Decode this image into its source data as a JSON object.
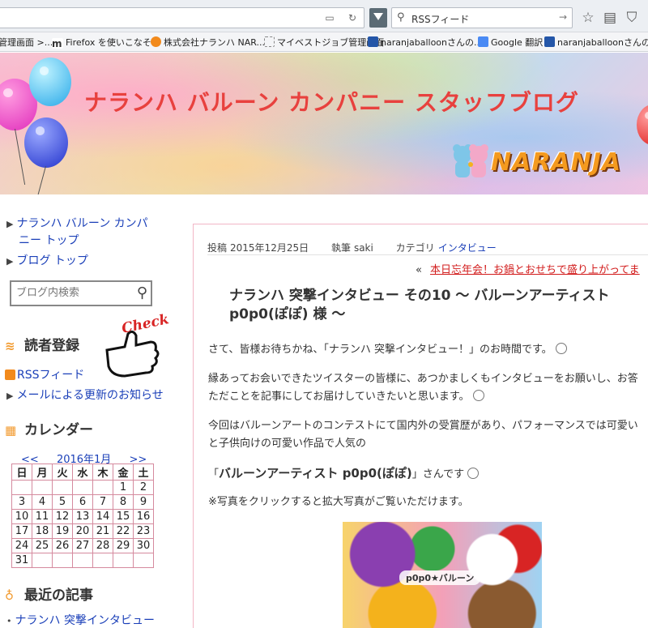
{
  "browser": {
    "search_value": "RSSフィード",
    "bookmarks": [
      "管理画面 >...",
      "Firefox を使いこなそう",
      "株式会社ナランハ NAR...",
      "マイベストジョブ管理画面",
      "naranjaballoonさんの...",
      "Google 翻訳",
      "naranjaballoonさんの..."
    ]
  },
  "header": {
    "blog_title": "ナランハ バルーン カンパニー スタッフブログ",
    "logo_text": "NARANJA"
  },
  "sidebar": {
    "links": [
      {
        "label": "ナランハ バルーン カンパ",
        "label2": "ニー トップ"
      },
      {
        "label": "ブログ トップ"
      }
    ],
    "search_placeholder": "ブログ内検索",
    "reader_heading": "読者登録",
    "check_label": "Check",
    "rss_label": "RSSフィード",
    "email_label": "メールによる更新のお知らせ",
    "calendar_heading": "カレンダー",
    "calendar": {
      "prev": "<<",
      "month": "2016年1月",
      "next": ">>",
      "weekdays": [
        "日",
        "月",
        "火",
        "水",
        "木",
        "金",
        "土"
      ],
      "weeks": [
        [
          "",
          "",
          "",
          "",
          "",
          "1",
          "2"
        ],
        [
          "3",
          "4",
          "5",
          "6",
          "7",
          "8",
          "9"
        ],
        [
          "10",
          "11",
          "12",
          "13",
          "14",
          "15",
          "16"
        ],
        [
          "17",
          "18",
          "19",
          "20",
          "21",
          "22",
          "23"
        ],
        [
          "24",
          "25",
          "26",
          "27",
          "28",
          "29",
          "30"
        ],
        [
          "31",
          "",
          "",
          "",
          "",
          "",
          ""
        ]
      ]
    },
    "recent_heading": "最近の記事",
    "recent_item": "ナランハ 突撃インタビュー"
  },
  "post": {
    "meta_post_label": "投稿",
    "meta_date": "2015年12月25日",
    "meta_author_label": "執筆",
    "meta_author": "saki",
    "meta_category_label": "カテゴリ",
    "meta_category": "インタビュー",
    "prev_arrow": "«",
    "prev_link": "本日忘年会！お鍋とおせちで盛り上がってま",
    "title_line1": "ナランハ 突撃インタビュー その10 ～ バルーンアーティスト",
    "title_line2": "p0p0(ぽぽ) 様 ～",
    "para1": "さて、皆様お待ちかね、「ナランハ 突撃インタビュー！」のお時間です。",
    "para2_line1": "縁あってお会いできたツイスターの皆様に、あつかましくもインタビューをお願いし、お答",
    "para2_line2": "ただことを記事にしてお届けしていきたいと思います。",
    "para3_line1": "今回はバルーンアートのコンテストにて国内外の受賞歴があり、パフォーマンスでは可愛い",
    "para3_line2": "と子供向けの可愛い作品で人気の",
    "subhead_open": "「",
    "subhead_bold": "バルーンアーティスト p0p0(ぽぽ)",
    "subhead_close": "」さんです",
    "photo_note": "※写真をクリックすると拡大写真がご覧いただけます。",
    "photo_caption": "p0p0★バルーン"
  },
  "colors": {
    "title_red": "#e8413e",
    "link_blue": "#1a3fb8",
    "calendar_border": "#d58a9e",
    "accent_orange": "#f29a2e"
  }
}
